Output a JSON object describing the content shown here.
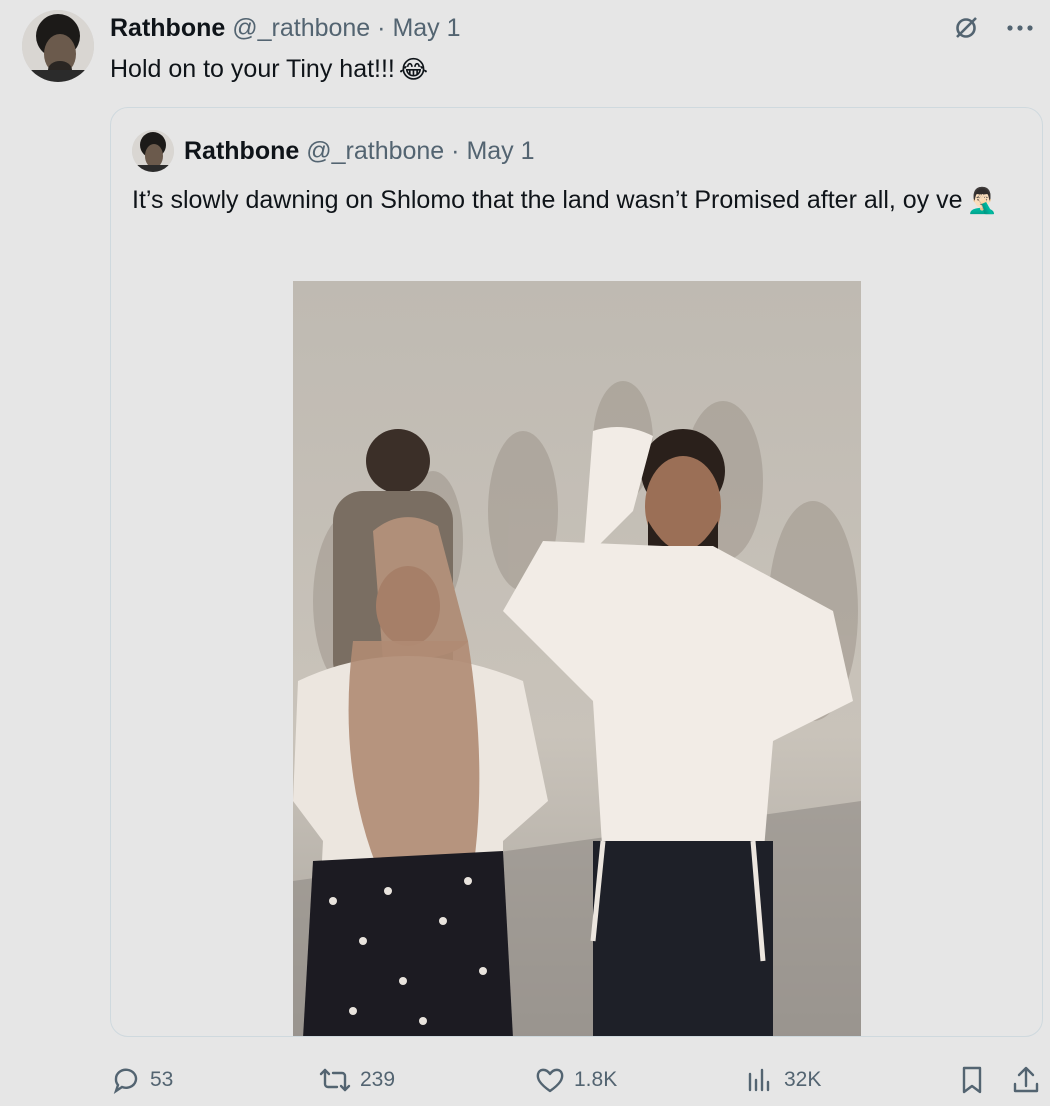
{
  "tweet": {
    "author_name": "Rathbone",
    "handle": "@_rathbone",
    "separator": "·",
    "date": "May 1",
    "text": "Hold on to your Tiny hat!!!",
    "emoji": "😂"
  },
  "quoted_tweet": {
    "author_name": "Rathbone",
    "handle": "@_rathbone",
    "separator": "·",
    "date": "May 1",
    "text": "It’s slowly dawning on Shlomo that the land wasn’t Promised after all, oy ve",
    "emoji": "🤦🏻‍♂️"
  },
  "actions": {
    "replies": "53",
    "reposts": "239",
    "likes": "1.8K",
    "views": "32K"
  },
  "icons": {
    "top": [
      "grok-icon",
      "more-icon"
    ],
    "bottom": [
      "reply-icon",
      "repost-icon",
      "like-icon",
      "views-icon",
      "bookmark-icon",
      "share-icon"
    ]
  },
  "colors": {
    "background": "#e6e6e6",
    "text": "#0f1419",
    "muted": "#536471",
    "border": "#cfd9de"
  }
}
